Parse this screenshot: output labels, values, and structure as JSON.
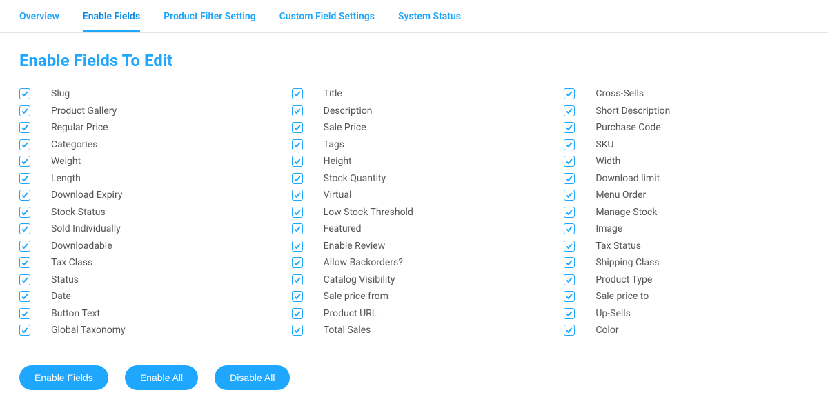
{
  "tabs": {
    "overview": "Overview",
    "enable_fields": "Enable Fields",
    "product_filter": "Product Filter Setting",
    "custom_field": "Custom Field Settings",
    "system_status": "System Status"
  },
  "title": "Enable Fields To Edit",
  "columns": [
    [
      "Slug",
      "Product Gallery",
      "Regular Price",
      "Categories",
      "Weight",
      "Length",
      "Download Expiry",
      "Stock Status",
      "Sold Individually",
      "Downloadable",
      "Tax Class",
      "Status",
      "Date",
      "Button Text",
      "Global Taxonomy"
    ],
    [
      "Title",
      "Description",
      "Sale Price",
      "Tags",
      "Height",
      "Stock Quantity",
      "Virtual",
      "Low Stock Threshold",
      "Featured",
      "Enable Review",
      "Allow Backorders?",
      "Catalog Visibility",
      "Sale price from",
      "Product URL",
      "Total Sales"
    ],
    [
      "Cross-Sells",
      "Short Description",
      "Purchase Code",
      "SKU",
      "Width",
      "Download limit",
      "Menu Order",
      "Manage Stock",
      "Image",
      "Tax Status",
      "Shipping Class",
      "Product Type",
      "Sale price to",
      "Up-Sells",
      "Color"
    ]
  ],
  "buttons": {
    "enable_fields": "Enable Fields",
    "enable_all": "Enable All",
    "disable_all": "Disable All"
  }
}
